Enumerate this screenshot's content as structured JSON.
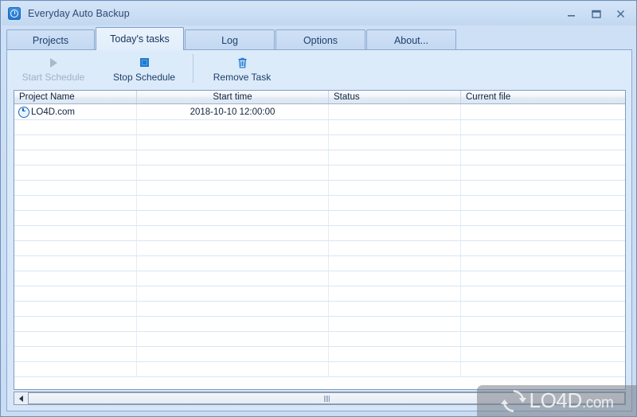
{
  "window": {
    "title": "Everyday Auto Backup",
    "app_icon": "alarm-clock-icon",
    "controls": {
      "minimize": "minimize-icon",
      "maximize": "maximize-icon",
      "close": "close-icon"
    }
  },
  "tabs": [
    {
      "label": "Projects",
      "active": false
    },
    {
      "label": "Today's tasks",
      "active": true
    },
    {
      "label": "Log",
      "active": false
    },
    {
      "label": "Options",
      "active": false
    },
    {
      "label": "About...",
      "active": false
    }
  ],
  "toolbar": {
    "buttons": [
      {
        "label": "Start Schedule",
        "icon": "play-icon",
        "enabled": false
      },
      {
        "label": "Stop Schedule",
        "icon": "stop-icon",
        "enabled": true
      },
      {
        "label": "Remove Task",
        "icon": "trash-icon",
        "enabled": true
      }
    ]
  },
  "grid": {
    "columns": [
      {
        "header": "Project Name",
        "align": "left"
      },
      {
        "header": "Start time",
        "align": "center"
      },
      {
        "header": "Status",
        "align": "left"
      },
      {
        "header": "Current file",
        "align": "left"
      }
    ],
    "rows": [
      {
        "icon": "clock-icon",
        "project_name": "LO4D.com",
        "start_time": "2018-10-10 12:00:00",
        "status": "",
        "current_file": ""
      }
    ],
    "empty_row_count": 17
  },
  "scrollbar": {
    "left_button": "scroll-left-arrow-icon",
    "grip": "scroll-thumb-grip"
  },
  "watermark": {
    "text": "LO4D",
    "suffix": ".com",
    "logo": "recycle-arrows-logo"
  },
  "colors": {
    "accent": "#1e7ad1",
    "window_bg": "#cfe0f5",
    "panel_bg": "#dcebfa",
    "title_text": "#2c4a73",
    "grid_line": "#d9e6f4"
  }
}
